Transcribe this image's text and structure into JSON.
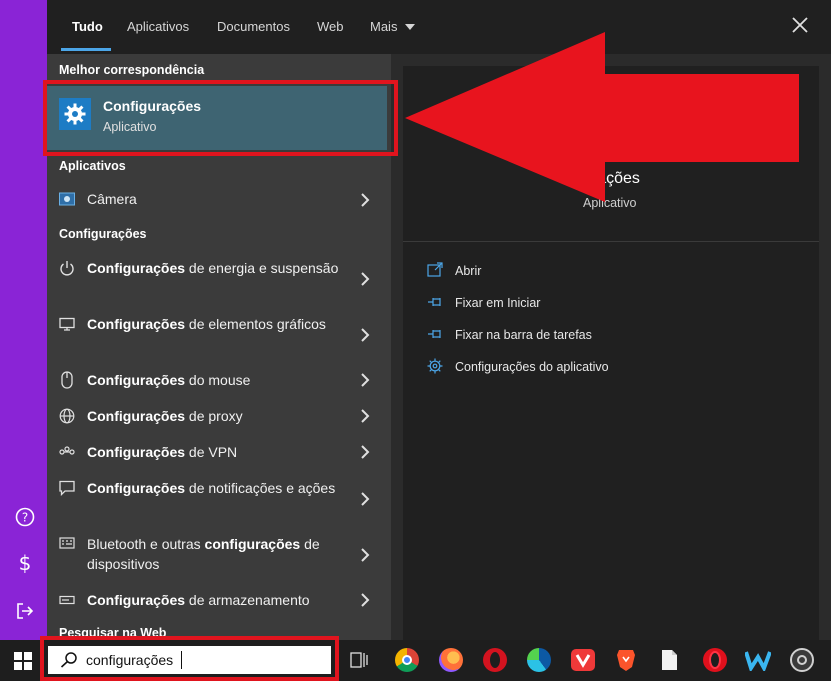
{
  "tabs": [
    {
      "label": "Tudo",
      "active": true
    },
    {
      "label": "Aplicativos"
    },
    {
      "label": "Documentos"
    },
    {
      "label": "Web"
    },
    {
      "label": "Mais"
    }
  ],
  "sections": {
    "best_match": "Melhor correspondência",
    "apps": "Aplicativos",
    "settings": "Configurações",
    "web": "Pesquisar na Web"
  },
  "best": {
    "title": "Configurações",
    "subtitle": "Aplicativo",
    "icon": "gear-icon"
  },
  "apps_items": [
    {
      "label": "Câmera",
      "icon": "camera-icon"
    }
  ],
  "settings_items": [
    {
      "bold": "Configurações",
      "rest": " de energia e suspensão",
      "icon": "power-icon"
    },
    {
      "bold": "Configurações",
      "rest": " de elementos gráficos",
      "icon": "monitor-icon"
    },
    {
      "bold": "Configurações",
      "rest": " do mouse",
      "icon": "mouse-icon"
    },
    {
      "bold": "Configurações",
      "rest": " de proxy",
      "icon": "globe-icon"
    },
    {
      "bold": "Configurações",
      "rest": " de VPN",
      "icon": "vpn-icon"
    },
    {
      "bold": "Configurações",
      "rest": " de notificações e ações",
      "icon": "notification-icon"
    },
    {
      "pre": "Bluetooth e outras ",
      "bold": "configurações",
      "rest": " de dispositivos",
      "icon": "bluetooth-devices-icon"
    },
    {
      "bold": "Configurações",
      "rest": " de armazenamento",
      "icon": "storage-icon"
    }
  ],
  "right": {
    "title": "urações",
    "subtitle": "Aplicativo",
    "actions": [
      {
        "label": "Abrir",
        "icon": "open-icon"
      },
      {
        "label": "Fixar em Iniciar",
        "icon": "pin-icon"
      },
      {
        "label": "Fixar na barra de tarefas",
        "icon": "pin-icon"
      },
      {
        "label": "Configurações do aplicativo",
        "icon": "gear-icon"
      }
    ]
  },
  "taskbar": {
    "search_value": "configurações",
    "apps": [
      "task-view-icon",
      "chrome-icon",
      "firefox-icon",
      "opera-icon",
      "edge-icon",
      "vivaldi-icon",
      "brave-icon",
      "file-icon",
      "opera-gx-icon",
      "wunderlist-icon",
      "obs-icon"
    ]
  },
  "colors": {
    "accent": "#4ca6e8",
    "annotation_red": "#e0141e",
    "sidebar_purple": "#8a24d6",
    "best_bg": "#3e6472"
  }
}
